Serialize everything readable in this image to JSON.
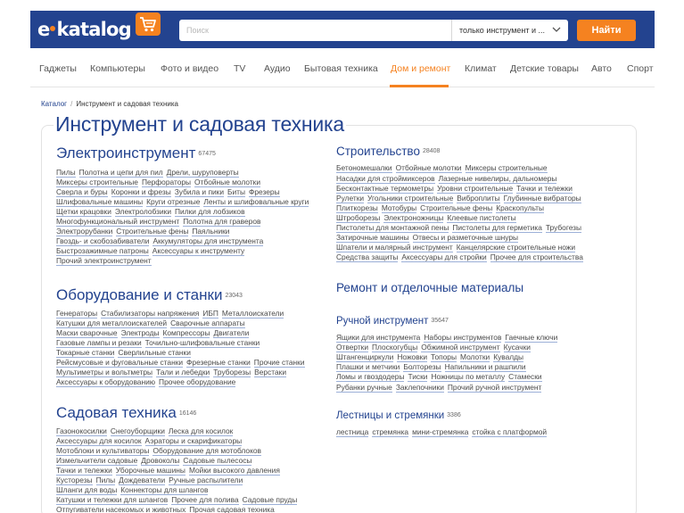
{
  "header": {
    "logo_text_left": "e",
    "logo_text_right": "katalog",
    "search_placeholder": "Поиск",
    "search_scope": "только инструмент и ...",
    "find_label": "Найти"
  },
  "colors": {
    "brand": "#23438f",
    "accent": "#f58220"
  },
  "nav": {
    "items": [
      "Гаджеты",
      "Компьютеры",
      "Фото и видео",
      "TV",
      "Аудио",
      "Бытовая техника",
      "Дом и ремонт",
      "Климат",
      "Детские товары",
      "Авто",
      "Спорт"
    ],
    "active": "Дом и ремонт"
  },
  "breadcrumb": {
    "root": "Каталог",
    "separator": "/",
    "current": "Инструмент и садовая техника"
  },
  "title": "Инструмент и садовая техника",
  "sections": [
    {
      "title": "Электроинструмент",
      "count": "67475",
      "lines": [
        [
          "Пилы",
          "Полотна и цепи для пил",
          "Дрели, шуруповерты"
        ],
        [
          "Миксеры строительные",
          "Перфораторы",
          "Отбойные молотки"
        ],
        [
          "Сверла и буры",
          "Коронки и фрезы",
          "Зубила и пики",
          "Биты",
          "Фрезеры"
        ],
        [
          "Шлифовальные машины",
          "Круги отрезные",
          "Ленты и шлифовальные круги"
        ],
        [
          "Щетки крацовки",
          "Электролобзики",
          "Пилки для лобзиков"
        ],
        [
          "Многофункциональный инструмент",
          "Полотна для граверов"
        ],
        [
          "Электрорубанки",
          "Строительные фены",
          "Паяльники"
        ],
        [
          "Гвоздь- и скобозабиватели",
          "Аккумуляторы для инструмента"
        ],
        [
          "Быстрозажимные патроны",
          "Аксессуары к инструменту"
        ],
        [
          "Прочий электроинструмент"
        ]
      ]
    },
    {
      "title": "Оборудование и станки",
      "count": "23043",
      "lines": [
        [
          "Генераторы",
          "Стабилизаторы напряжения",
          "ИБП",
          "Металлоискатели"
        ],
        [
          "Катушки для металлоискателей",
          "Сварочные аппараты"
        ],
        [
          "Маски сварочные",
          "Электроды",
          "Компрессоры",
          "Двигатели"
        ],
        [
          "Газовые лампы и резаки",
          "Точильно-шлифовальные станки"
        ],
        [
          "Токарные станки",
          "Сверлильные станки"
        ],
        [
          "Рейсмусовые и фуговальные станки",
          "Фрезерные станки",
          "Прочие станки"
        ],
        [
          "Мультиметры и вольтметры",
          "Тали и лебедки",
          "Труборезы",
          "Верстаки"
        ],
        [
          "Аксессуары к оборудованию",
          "Прочее оборудование"
        ]
      ]
    },
    {
      "title": "Садовая техника",
      "count": "16146",
      "lines": [
        [
          "Газонокосилки",
          "Снегоуборщики",
          "Леска для косилок"
        ],
        [
          "Аксессуары для косилок",
          "Аэраторы и скарификаторы"
        ],
        [
          "Мотоблоки и культиваторы",
          "Оборудование для мотоблоков"
        ],
        [
          "Измельчители садовые",
          "Дровоколы",
          "Садовые пылесосы"
        ],
        [
          "Тачки и тележки",
          "Уборочные машины",
          "Мойки высокого давления"
        ],
        [
          "Кусторезы",
          "Пилы",
          "Дождеватели",
          "Ручные распылители"
        ],
        [
          "Шланги для воды",
          "Коннекторы для шлангов"
        ],
        [
          "Катушки и тележки для шлангов",
          "Прочее для полива",
          "Садовые пруды"
        ],
        [
          "Отпугиватели насекомых и животных",
          "Прочая садовая техника"
        ]
      ]
    },
    {
      "title": "Строительство",
      "count": "28408",
      "lines": [
        [
          "Бетономешалки",
          "Отбойные молотки",
          "Миксеры строительные"
        ],
        [
          "Насадки для строймиксеров",
          "Лазерные нивелиры, дальномеры"
        ],
        [
          "Бесконтактные термометры",
          "Уровни строительные",
          "Тачки и тележки"
        ],
        [
          "Рулетки",
          "Угольники строительные",
          "Виброплиты",
          "Глубинные вибраторы"
        ],
        [
          "Плиткорезы",
          "Мотобуры",
          "Строительные фены",
          "Краскопульты"
        ],
        [
          "Штроборезы",
          "Электроножницы",
          "Клеевые пистолеты"
        ],
        [
          "Пистолеты для монтажной пены",
          "Пистолеты для герметика",
          "Трубогезы"
        ],
        [
          "Затирочные машины",
          "Отвесы и разметочные шнуры"
        ],
        [
          "Шпатели и малярный инструмент",
          "Канцелярские строительные ножи"
        ],
        [
          "Средства защиты",
          "Аксессуары для стройки",
          "Прочее для строительства"
        ]
      ]
    },
    {
      "title": "Ремонт и отделочные материалы",
      "count": "",
      "lines": []
    },
    {
      "title": "Ручной инструмент",
      "count": "35647",
      "lines": [
        [
          "Ящики для инструмента",
          "Наборы инструментов",
          "Гаечные ключи"
        ],
        [
          "Отвертки",
          "Плоскогубцы",
          "Обжимной инструмент",
          "Кусачки"
        ],
        [
          "Штангенциркули",
          "Ножовки",
          "Топоры",
          "Молотки",
          "Кувалды"
        ],
        [
          "Плашки и метчики",
          "Болторезы",
          "Напильники и рашпили"
        ],
        [
          "Ломы и гвоздодеры",
          "Тиски",
          "Ножницы по металлу",
          "Стамески"
        ],
        [
          "Рубанки ручные",
          "Заклепочники",
          "Прочий ручной инструмент"
        ]
      ]
    },
    {
      "title": "Лестницы и стремянки",
      "count": "3386",
      "lines": [
        [
          "лестница",
          "стремянка",
          "мини-стремянка",
          "стойка с платформой"
        ]
      ]
    }
  ]
}
